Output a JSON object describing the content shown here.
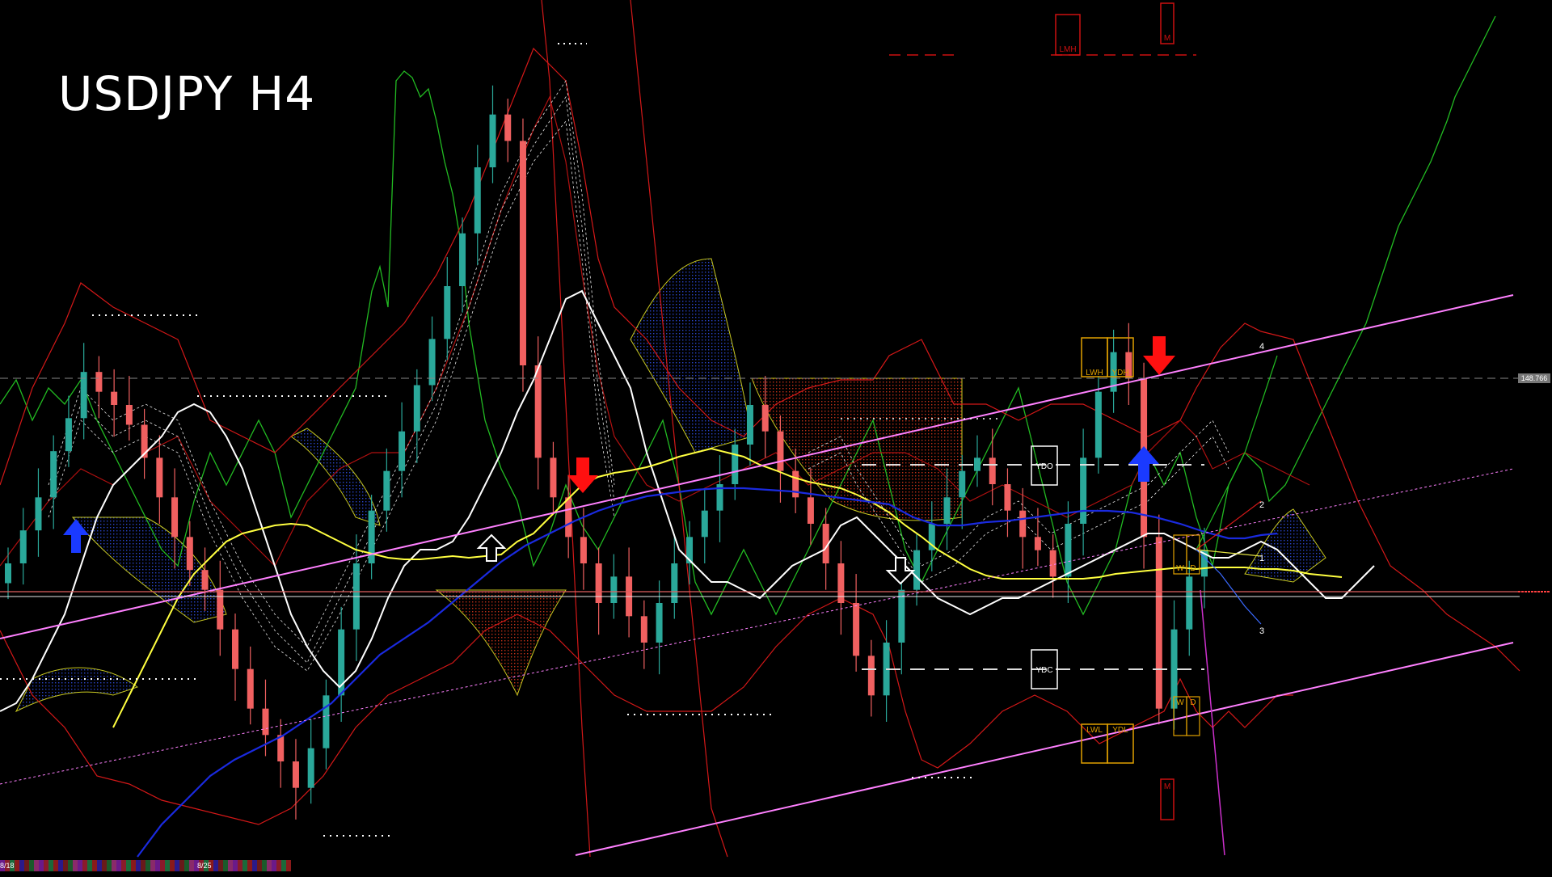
{
  "title": "USDJPY H4",
  "price_tag": "148.766",
  "level_labels": {
    "lmh": "LMH",
    "m_top": "M",
    "m_bottom": "M",
    "lwh": "LWH",
    "ydh": "YDH",
    "ydo": "YDO",
    "ydc": "YDC",
    "lwl": "LWL",
    "ydl": "YDL",
    "w_upper": "W",
    "d_upper": "D",
    "w_lower": "W",
    "d_lower": "D"
  },
  "projection_labels": [
    "4",
    "2",
    "1",
    "3"
  ],
  "bottom_dates": [
    "8/18",
    "8/25"
  ],
  "colors": {
    "bull": "#2aa89a",
    "bear": "#f06060",
    "channel": "#ff80ff",
    "ma_white": "#ffffff",
    "ma_yellow": "#ffff40",
    "ma_blue": "#1a2adf",
    "bands": "#d41818",
    "oscillator": "#22bb22",
    "cloud_blue": "#1a2a90",
    "cloud_red": "#a02010",
    "arrow_red": "#ff1010",
    "arrow_blue": "#1a3aff",
    "level_box": "#e0a000"
  },
  "chart_data": {
    "type": "candlestick",
    "symbol": "USDJPY",
    "timeframe": "H4",
    "dates": [
      "8/18",
      "8/25"
    ],
    "marker_price": 148.766,
    "series": [
      {
        "name": "close",
        "values": [
          147.1,
          147.35,
          147.6,
          147.95,
          148.2,
          148.55,
          148.4,
          148.3,
          148.15,
          147.9,
          147.6,
          147.3,
          147.05,
          146.9,
          146.6,
          146.3,
          146.0,
          145.8,
          145.6,
          145.4,
          145.7,
          146.1,
          146.6,
          147.1,
          147.5,
          147.8,
          148.1,
          148.45,
          148.8,
          149.2,
          149.6,
          150.1,
          150.5,
          150.3,
          148.6,
          147.9,
          147.6,
          147.3,
          147.1,
          146.8,
          147.0,
          146.7,
          146.5,
          146.8,
          147.1,
          147.3,
          147.5,
          147.7,
          148.0,
          148.3,
          148.1,
          147.8,
          147.6,
          147.4,
          147.1,
          146.8,
          146.4,
          146.1,
          146.5,
          146.9,
          147.2,
          147.4,
          147.6,
          147.8,
          147.9,
          147.7,
          147.5,
          147.3,
          147.2,
          147.0,
          147.4,
          147.9,
          148.4,
          148.7,
          148.5,
          147.3,
          146.0,
          146.6,
          147.0,
          147.2
        ]
      }
    ]
  }
}
